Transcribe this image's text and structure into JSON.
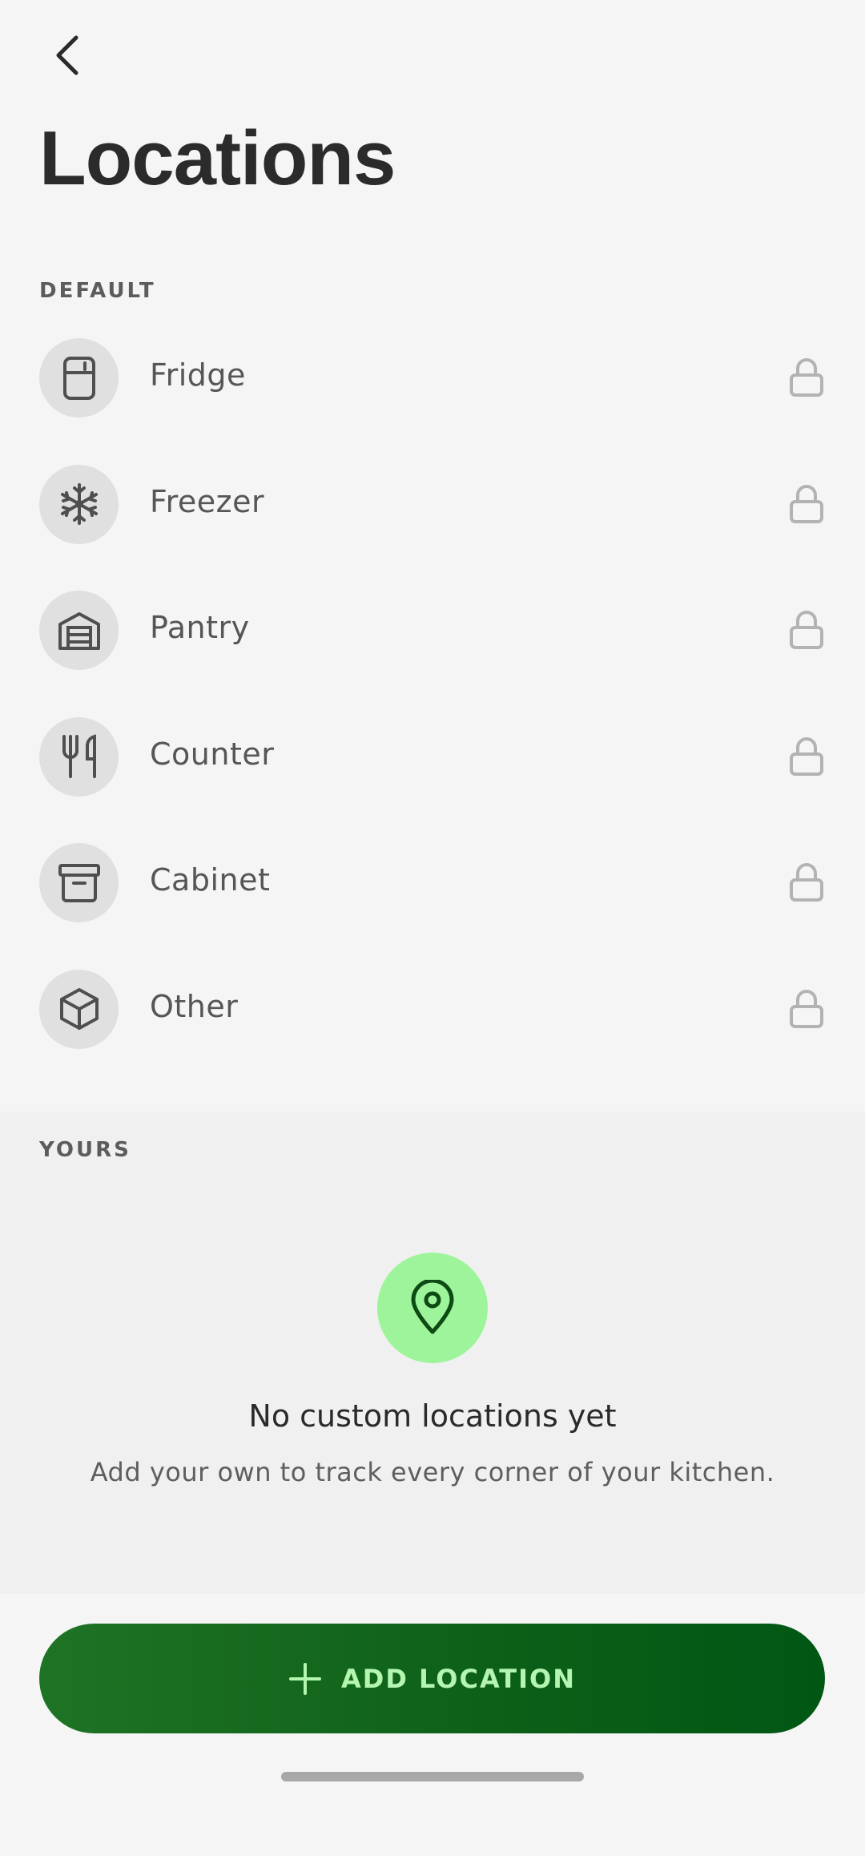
{
  "header": {
    "title": "Locations"
  },
  "sections": {
    "default_label": "DEFAULT",
    "yours_label": "YOURS"
  },
  "default_locations": [
    {
      "label": "Fridge",
      "icon": "fridge-icon",
      "locked": true
    },
    {
      "label": "Freezer",
      "icon": "snowflake-icon",
      "locked": true
    },
    {
      "label": "Pantry",
      "icon": "pantry-icon",
      "locked": true
    },
    {
      "label": "Counter",
      "icon": "utensils-icon",
      "locked": true
    },
    {
      "label": "Cabinet",
      "icon": "archive-box-icon",
      "locked": true
    },
    {
      "label": "Other",
      "icon": "cube-icon",
      "locked": true
    }
  ],
  "empty_state": {
    "icon": "map-pin-icon",
    "title": "No custom locations yet",
    "description": "Add your own to track every corner of your kitchen."
  },
  "actions": {
    "add_label": "ADD LOCATION"
  },
  "colors": {
    "accent": "#0c5f17",
    "accent_text": "#b4f5b0",
    "empty_icon_bg": "#9df49a",
    "icon_bg": "#dfe0df"
  }
}
